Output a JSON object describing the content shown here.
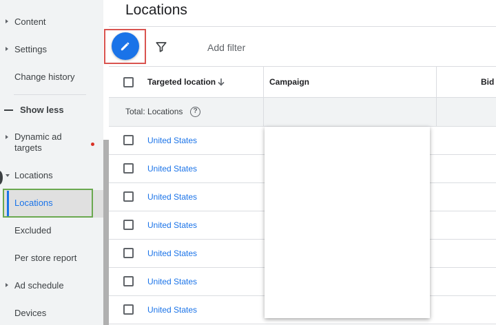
{
  "sidebar": {
    "items": [
      {
        "label": "Content",
        "caret": "right"
      },
      {
        "label": "Settings",
        "caret": "right"
      },
      {
        "label": "Change history",
        "caret": ""
      },
      {
        "label": "Show less",
        "caret": "minus"
      },
      {
        "label": "Dynamic ad targets",
        "caret": "right"
      },
      {
        "label": "Locations",
        "caret": "down"
      },
      {
        "label": "Locations",
        "caret": "",
        "active": true
      },
      {
        "label": "Excluded",
        "caret": ""
      },
      {
        "label": "Per store report",
        "caret": ""
      },
      {
        "label": "Ad schedule",
        "caret": "right"
      },
      {
        "label": "Devices",
        "caret": ""
      }
    ],
    "dynamic_targets_line1": "Dynamic ad",
    "dynamic_targets_line2": "targets"
  },
  "header": {
    "title": "Locations"
  },
  "toolbar": {
    "edit_icon": "pencil-icon",
    "filter_icon": "funnel-icon",
    "add_filter_label": "Add filter"
  },
  "table": {
    "columns": [
      {
        "label": "Targeted location",
        "sort": "descending"
      },
      {
        "label": "Campaign"
      },
      {
        "label": "Bid"
      }
    ],
    "total_label": "Total: Locations",
    "rows": [
      {
        "location": "United States"
      },
      {
        "location": "United States"
      },
      {
        "location": "United States"
      },
      {
        "location": "United States"
      },
      {
        "location": "United States"
      },
      {
        "location": "United States"
      },
      {
        "location": "United States"
      }
    ]
  },
  "colors": {
    "accent": "#1a73e8",
    "highlight_green": "#6aa84f",
    "highlight_red": "#d9534f",
    "notification_red": "#d93025"
  }
}
